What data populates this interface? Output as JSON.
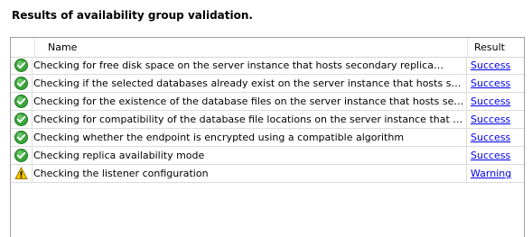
{
  "heading": "Results of availability group validation.",
  "columns": {
    "name": "Name",
    "result": "Result"
  },
  "rows": [
    {
      "icon": "success-check-icon",
      "name": "Checking for free disk space on the server instance that hosts secondary replica",
      "redacted": true,
      "ellipsis": "...",
      "result": "Success"
    },
    {
      "icon": "success-check-icon",
      "name": "Checking if the selected databases already exist on the server instance that hosts second...",
      "result": "Success"
    },
    {
      "icon": "success-check-icon",
      "name": "Checking for the existence of the database files on the server instance that hosts seconda...",
      "result": "Success"
    },
    {
      "icon": "success-check-icon",
      "name": "Checking for compatibility of the database file locations on the server instance that host...",
      "result": "Success"
    },
    {
      "icon": "success-check-icon",
      "name": "Checking whether the endpoint is encrypted using a compatible algorithm",
      "result": "Success"
    },
    {
      "icon": "success-check-icon",
      "name": "Checking replica availability mode",
      "result": "Success"
    },
    {
      "icon": "warning-icon",
      "name": "Checking the listener configuration",
      "result": "Warning"
    }
  ],
  "colors": {
    "success": "#2e9b2e",
    "warning": "#f2c200",
    "link": "#0000ee"
  }
}
